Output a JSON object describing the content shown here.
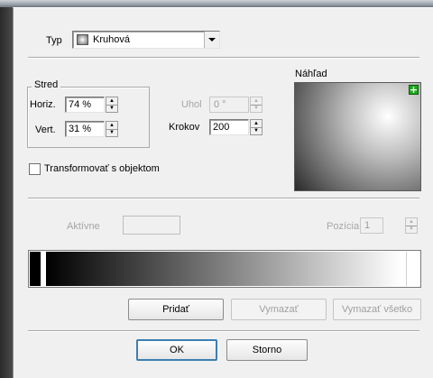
{
  "type_row": {
    "label": "Typ",
    "value": "Kruhová"
  },
  "center_group": {
    "title": "Stred",
    "horiz_label": "Horiz.",
    "horiz_value": "74 %",
    "vert_label": "Vert.",
    "vert_value": "31 %"
  },
  "angle": {
    "label": "Uhol",
    "value": "0 °"
  },
  "steps": {
    "label": "Krokov",
    "value": "200"
  },
  "transform_checkbox": {
    "label": "Transformovať s objektom",
    "checked": false
  },
  "preview": {
    "label": "Náhľad",
    "add_icon": "plus-icon"
  },
  "active": {
    "label": "Aktívne",
    "value": ""
  },
  "position": {
    "label": "Pozícia",
    "value": "1"
  },
  "gradient_buttons": {
    "add": "Pridať",
    "delete": "Vymazať",
    "delete_all": "Vymazať všetko"
  },
  "dialog_buttons": {
    "ok": "OK",
    "cancel": "Storno"
  },
  "colors": {
    "dialog_bg": "#f0f0f0",
    "add_icon": "#1aa81a"
  }
}
